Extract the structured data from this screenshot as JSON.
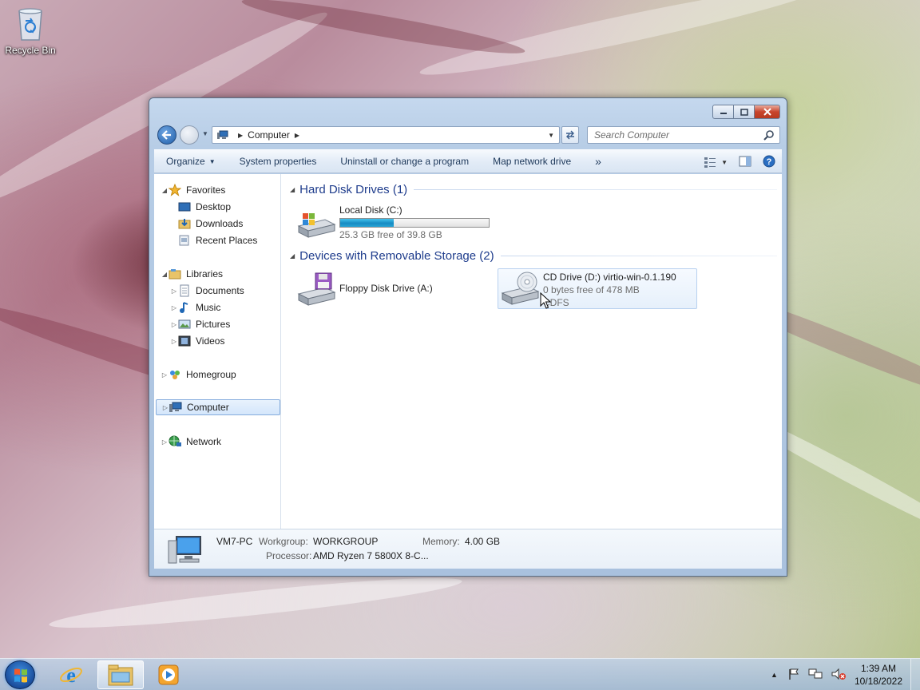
{
  "desktop": {
    "icons": [
      {
        "label": "Recycle Bin",
        "icon": "recycle-bin-icon"
      }
    ]
  },
  "window": {
    "address": {
      "path": [
        "Computer"
      ]
    },
    "search": {
      "placeholder": "Search Computer"
    },
    "toolbar": {
      "items": [
        "Organize",
        "System properties",
        "Uninstall or change a program",
        "Map network drive"
      ],
      "more": "»"
    },
    "navpane": {
      "favorites": {
        "label": "Favorites",
        "items": [
          "Desktop",
          "Downloads",
          "Recent Places"
        ]
      },
      "libraries": {
        "label": "Libraries",
        "items": [
          "Documents",
          "Music",
          "Pictures",
          "Videos"
        ]
      },
      "homegroup": "Homegroup",
      "computer": "Computer",
      "network": "Network"
    },
    "groups": {
      "hard_disk": {
        "title": "Hard Disk Drives (1)",
        "drives": [
          {
            "name": "Local Disk (C:)",
            "free_text": "25.3 GB free of 39.8 GB",
            "used_fraction": 0.36
          }
        ]
      },
      "removable": {
        "title": "Devices with Removable Storage (2)",
        "drives": [
          {
            "name": "Floppy Disk Drive (A:)"
          },
          {
            "name": "CD Drive (D:) virtio-win-0.1.190",
            "free_text": "0 bytes free of 478 MB",
            "fs": "CDFS"
          }
        ]
      }
    },
    "details": {
      "computer_name": "VM7-PC",
      "workgroup_label": "Workgroup:",
      "workgroup": "WORKGROUP",
      "memory_label": "Memory:",
      "memory": "4.00 GB",
      "processor_label": "Processor:",
      "processor": "AMD Ryzen 7 5800X 8-C..."
    }
  },
  "taskbar": {
    "apps": [
      "internet-explorer-icon",
      "windows-explorer-icon",
      "media-player-icon"
    ],
    "clock": {
      "time": "1:39 AM",
      "date": "10/18/2022"
    }
  }
}
